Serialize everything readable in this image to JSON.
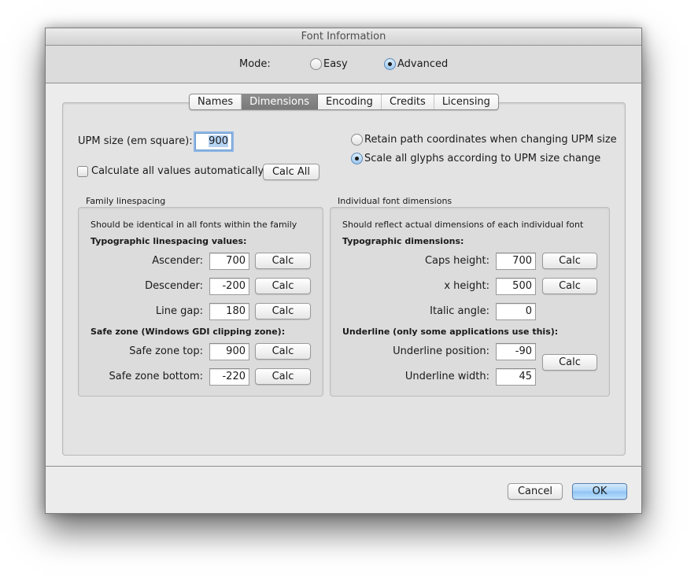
{
  "window": {
    "title": "Font Information"
  },
  "mode": {
    "label": "Mode:",
    "options": [
      {
        "label": "Easy",
        "selected": false
      },
      {
        "label": "Advanced",
        "selected": true
      }
    ]
  },
  "tabs": [
    {
      "label": "Names",
      "active": false
    },
    {
      "label": "Dimensions",
      "active": true
    },
    {
      "label": "Encoding",
      "active": false
    },
    {
      "label": "Credits",
      "active": false
    },
    {
      "label": "Licensing",
      "active": false
    }
  ],
  "upm": {
    "label": "UPM size (em square):",
    "value": "900",
    "options": [
      {
        "label": "Retain path coordinates when changing UPM size",
        "selected": false
      },
      {
        "label": "Scale all glyphs according to UPM size change",
        "selected": true
      }
    ],
    "auto_calc_label": "Calculate all values automatically",
    "auto_calc_checked": false,
    "calc_all_label": "Calc All"
  },
  "family": {
    "title": "Family linespacing",
    "note": "Should be identical in all fonts within the family",
    "typo_heading": "Typographic linespacing values:",
    "ascender": {
      "label": "Ascender:",
      "value": "700",
      "button": "Calc"
    },
    "descender": {
      "label": "Descender:",
      "value": "-200",
      "button": "Calc"
    },
    "line_gap": {
      "label": "Line gap:",
      "value": "180",
      "button": "Calc"
    },
    "safe_heading": "Safe zone (Windows GDI clipping zone):",
    "safe_top": {
      "label": "Safe zone top:",
      "value": "900",
      "button": "Calc"
    },
    "safe_bottom": {
      "label": "Safe zone bottom:",
      "value": "-220",
      "button": "Calc"
    }
  },
  "individual": {
    "title": "Individual font dimensions",
    "note": "Should reflect actual dimensions of each individual font",
    "typo_heading": "Typographic dimensions:",
    "caps_height": {
      "label": "Caps height:",
      "value": "700",
      "button": "Calc"
    },
    "x_height": {
      "label": "x height:",
      "value": "500",
      "button": "Calc"
    },
    "italic_angle": {
      "label": "Italic angle:",
      "value": "0"
    },
    "underline_heading": "Underline (only some applications use this):",
    "underline_position": {
      "label": "Underline position:",
      "value": "-90"
    },
    "underline_width": {
      "label": "Underline width:",
      "value": "45"
    },
    "underline_button": "Calc"
  },
  "footer": {
    "cancel_label": "Cancel",
    "ok_label": "OK"
  }
}
